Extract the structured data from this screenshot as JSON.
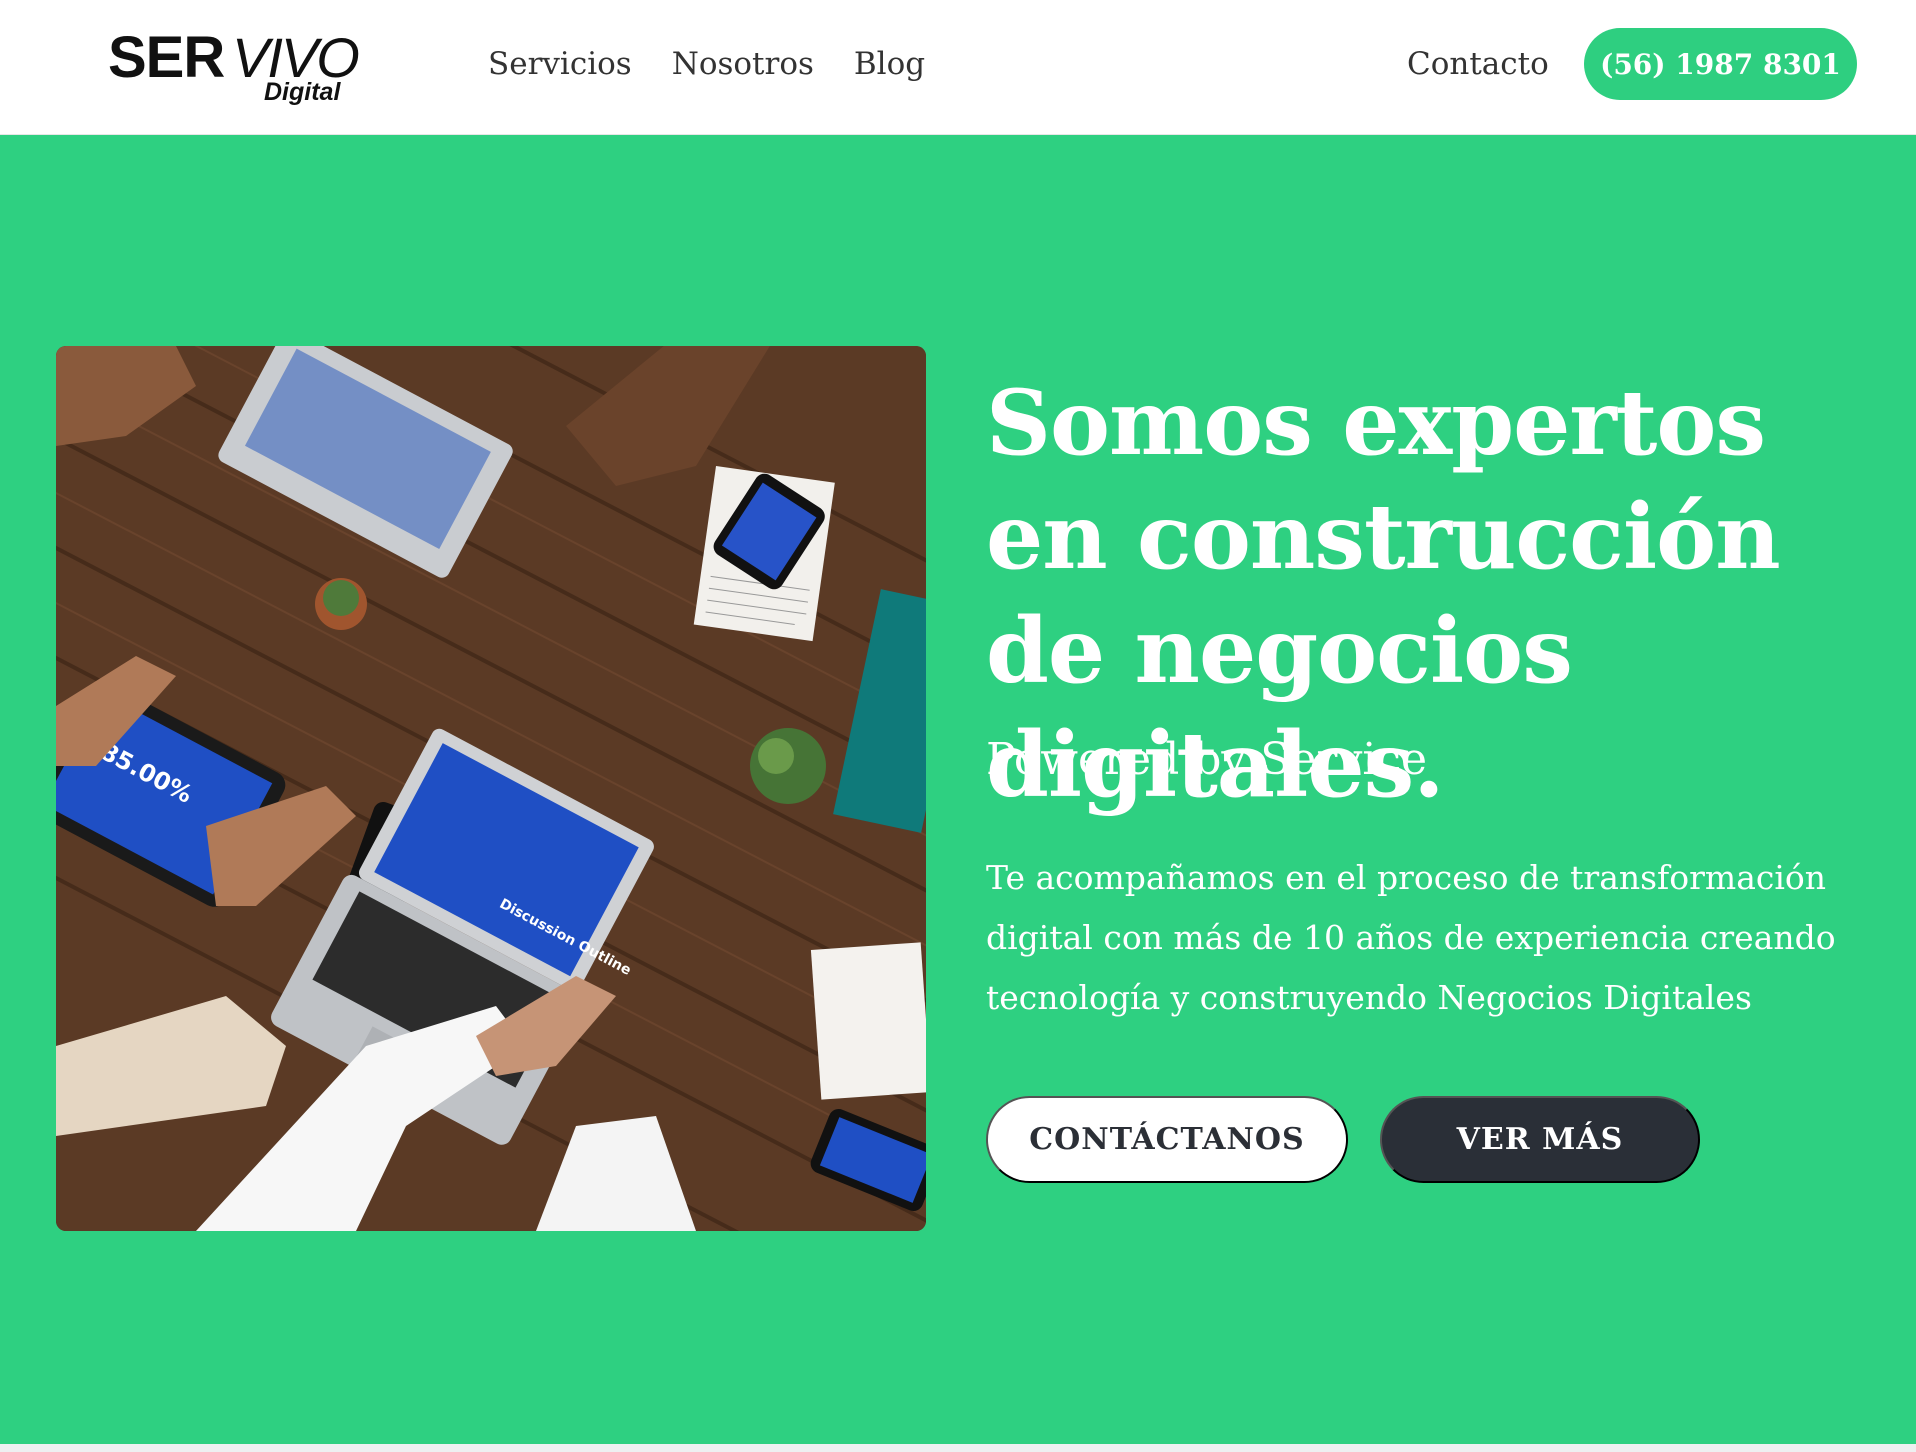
{
  "brand": {
    "logo_ser": "SER",
    "logo_vivo": "VIVO",
    "logo_digital": "Digital"
  },
  "nav": {
    "items": [
      {
        "label": "Servicios"
      },
      {
        "label": "Nosotros"
      },
      {
        "label": "Blog"
      }
    ],
    "contact_label": "Contacto",
    "phone_label": "(56) 1987 8301"
  },
  "hero": {
    "title": "Somos expertos en construcción de negocios digitales.",
    "subtitle": "Powered by Service",
    "description": "Te acompañamos en el proceso de transformación digital con más de 10 años de experiencia creando tecnología y construyendo Negocios Digitales",
    "primary_button": "CONTÁCTANOS",
    "secondary_button": "VER MÁS",
    "photo_screen_text": "85.00%",
    "photo_laptop_text": "Discussion Outline"
  },
  "colors": {
    "accent": "#2ed081",
    "dark": "#2a2f37",
    "white": "#ffffff"
  }
}
